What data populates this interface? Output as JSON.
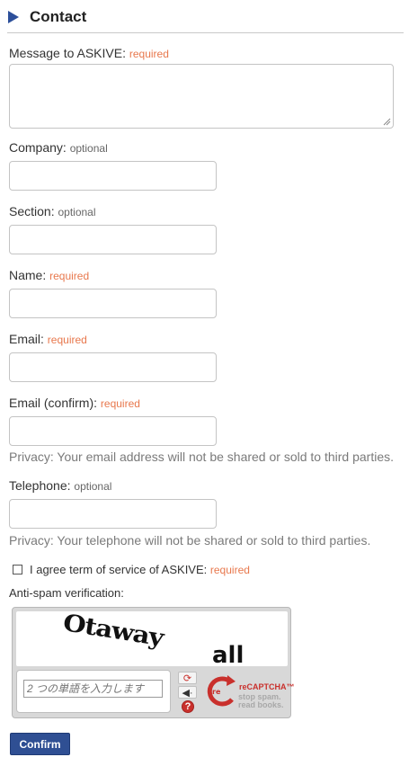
{
  "header": {
    "title": "Contact"
  },
  "form": {
    "message": {
      "label": "Message to ASKIVE:",
      "tag": "required",
      "value": ""
    },
    "company": {
      "label": "Company:",
      "tag": "optional",
      "value": ""
    },
    "section": {
      "label": "Section:",
      "tag": "optional",
      "value": ""
    },
    "name": {
      "label": "Name:",
      "tag": "required",
      "value": ""
    },
    "email": {
      "label": "Email:",
      "tag": "required",
      "value": ""
    },
    "email_confirm": {
      "label": "Email (confirm):",
      "tag": "required",
      "value": "",
      "privacy": "Privacy: Your email address will not be shared or sold to third parties."
    },
    "telephone": {
      "label": "Telephone:",
      "tag": "optional",
      "value": "",
      "privacy": "Privacy: Your telephone will not be shared or sold to third parties."
    },
    "agree": {
      "label": "I agree term of service of ASKIVE:",
      "tag": "required",
      "checked": false
    },
    "antispam": {
      "label": "Anti-spam verification:",
      "words": [
        "Otaway",
        "all"
      ],
      "placeholder": "2 つの単語を入力します",
      "logo_text": "reCAPTCHA™",
      "logo_tag_1": "stop spam.",
      "logo_tag_2": "read books.",
      "buttons": [
        "refresh-icon",
        "audio-icon",
        "help-icon"
      ]
    },
    "confirm_label": "Confirm"
  },
  "colors": {
    "accent": "#2f4f93",
    "required": "#e8784d",
    "captcha_red": "#c9302c"
  }
}
